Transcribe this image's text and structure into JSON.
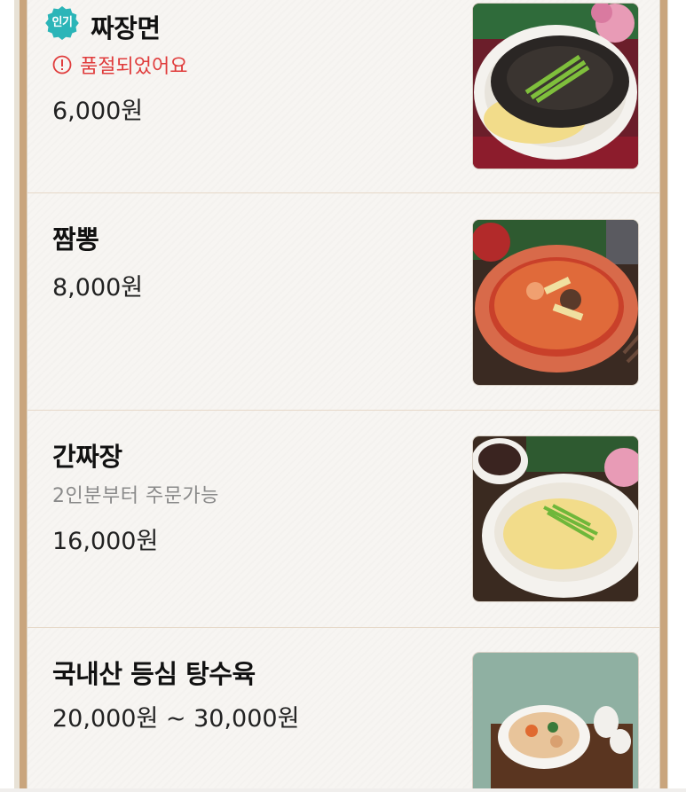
{
  "menu": {
    "items": [
      {
        "badge": "인기",
        "name": "짜장면",
        "status": "품절되었어요",
        "note": "",
        "price": "6,000원",
        "image_icon": "jajangmyeon-photo"
      },
      {
        "badge": "",
        "name": "짬뽕",
        "status": "",
        "note": "",
        "price": "8,000원",
        "image_icon": "jjamppong-photo"
      },
      {
        "badge": "",
        "name": "간짜장",
        "status": "",
        "note": "2인분부터 주문가능",
        "price": "16,000원",
        "image_icon": "ganjjajang-photo"
      },
      {
        "badge": "",
        "name": "국내산 등심 탕수육",
        "status": "",
        "note": "",
        "price": "20,000원 ~ 30,000원",
        "image_icon": "tangsuyuk-photo"
      }
    ]
  },
  "colors": {
    "frame_border": "#c9a57d",
    "badge": "#2bb5b8",
    "soldout": "#e03c3c",
    "note": "#8a8a8a",
    "item_divider": "#e6d8c8"
  }
}
